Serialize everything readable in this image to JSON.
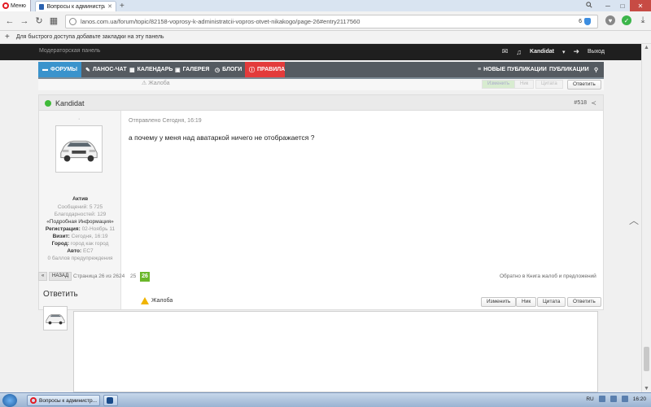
{
  "browser": {
    "menu_label": "Меню",
    "tab_title": "Вопросы к администрации",
    "url": "lanos.com.ua/forum/topic/82158-voprosy-k-administratcii-vopros-otvet-nikakogo/page-26#entry2117560",
    "url_badge_count": "6",
    "bookmarks_hint": "Для быстрого доступа добавьте закладки на эту панель"
  },
  "userbar": {
    "mod_panel": "Модераторская панель",
    "username": "Kandidat",
    "logout": "Выход"
  },
  "nav": {
    "items": [
      "ФОРУМЫ",
      "ЛАНОС-ЧАТ",
      "КАЛЕНДАРЬ",
      "ГАЛЕРЕЯ",
      "БЛОГИ",
      "ПРАВИЛА"
    ],
    "right_items": [
      "НОВЫЕ ПУБЛИКАЦИИ",
      "ПУБЛИКАЦИИ"
    ]
  },
  "prev_post": {
    "complaint": "Жалоба",
    "buttons": [
      "Изменить",
      "Ник",
      "Цитата",
      "Ответить"
    ]
  },
  "post": {
    "author": "Kandidat",
    "number": "#518",
    "dot": "·",
    "rank": "Актив",
    "messages": "Сообщений: 5 725",
    "thanks": "Благодарностей: 129",
    "details": "«Подробная Информация»",
    "registration_label": "Регистрация:",
    "registration_value": "02-Ноябрь 11",
    "visit_label": "Визит:",
    "visit_value": "Сегодня, 16:19",
    "city_label": "Город:",
    "city_value": "город как город",
    "auto_label": "Авто:",
    "auto_value": "EC7",
    "warnings": "0 баллов предупреждения",
    "date": "Отправлено Сегодня, 16:19",
    "body": "а почему у меня над аватаркой ничего не отображается ?",
    "complaint": "Жалоба",
    "buttons": [
      "Изменить",
      "Ник",
      "Цитата",
      "Ответить"
    ]
  },
  "pager": {
    "prev_arrow": "«",
    "back": "НАЗАД",
    "pages_info": "Страница 26 из 26",
    "pages": [
      "24",
      "25"
    ],
    "current": "26",
    "complaints_link": "Обратно в Книга жалоб и предложений"
  },
  "reply": {
    "title": "Ответить"
  },
  "taskbar": {
    "task_title": "Вопросы к администр...",
    "lang": "RU",
    "time": "16:20"
  },
  "colors": {
    "nav_active": "#3a93cc",
    "nav_rules": "#e33b3b",
    "online": "#3fba39",
    "current_page": "#6bb72b"
  }
}
